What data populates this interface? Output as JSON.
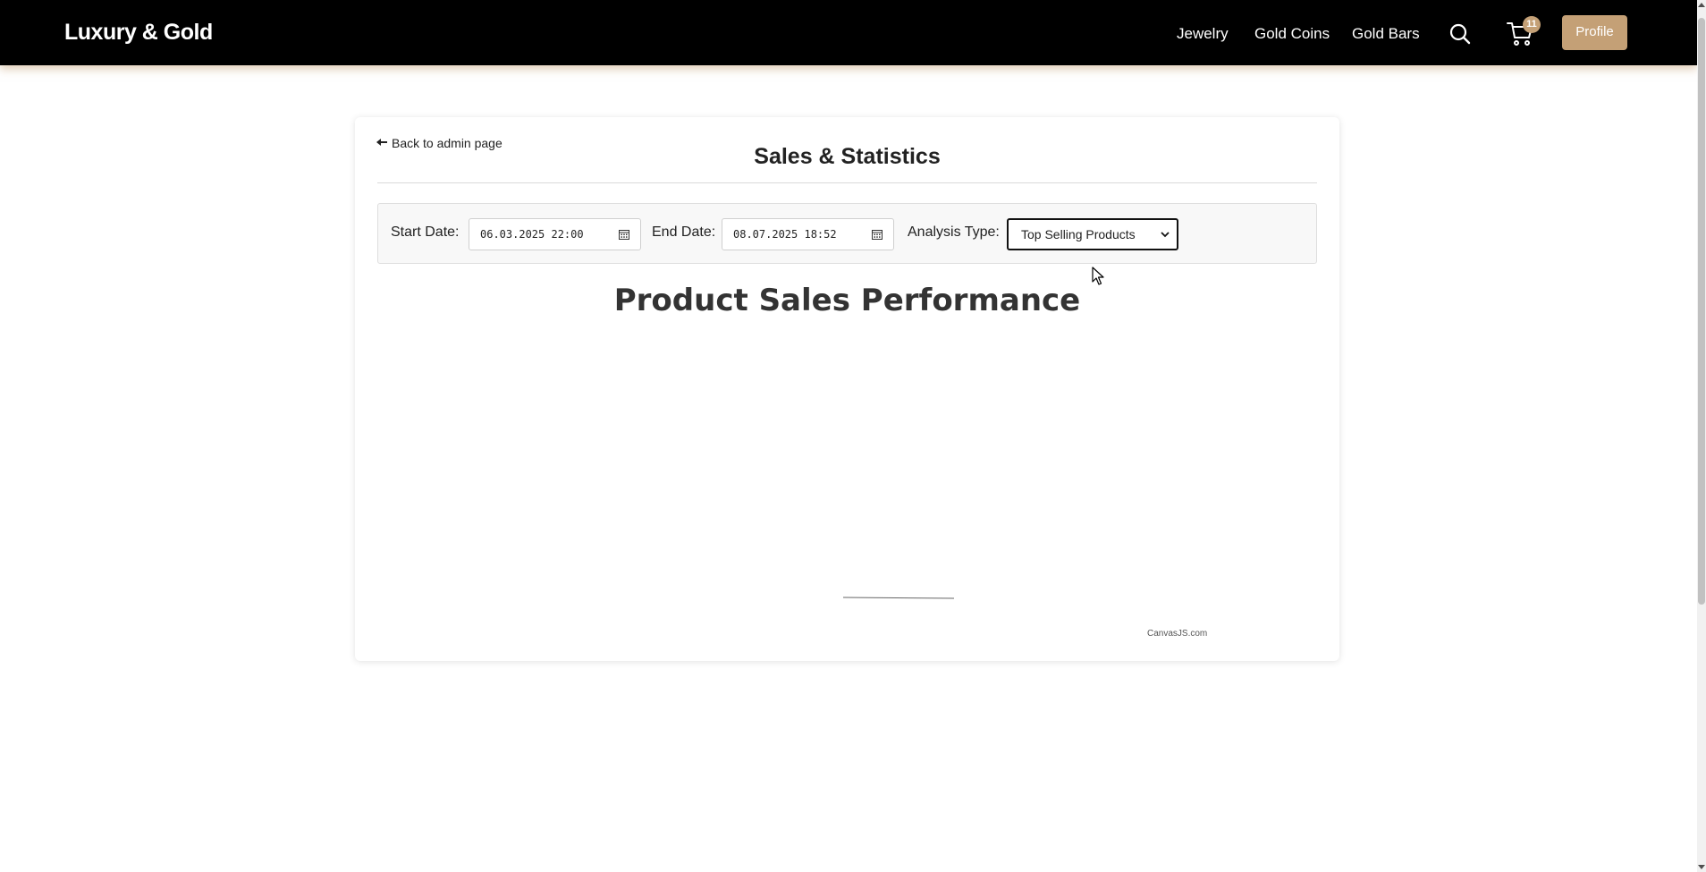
{
  "header": {
    "brand": "Luxury & Gold",
    "nav": [
      {
        "label": "Jewelry"
      },
      {
        "label": "Gold Coins"
      },
      {
        "label": "Gold Bars"
      }
    ],
    "icons": {
      "search": "search-icon",
      "cart": "cart-icon"
    },
    "cart_count": "11",
    "profile_label": "Profile",
    "colors": {
      "background": "#000000",
      "accent": "#c4a076"
    }
  },
  "page": {
    "back_link": "Back to admin page",
    "title": "Sales & Statistics"
  },
  "filters": {
    "start_label": "Start Date:",
    "start_value": "06.03.2025 22:00",
    "end_label": "End Date:",
    "end_value": "08.07.2025 18:52",
    "type_label": "Analysis Type:",
    "type_value": "Top Selling Products"
  },
  "chart_data": {
    "type": "bar",
    "title": "Product Sales Performance",
    "categories": [],
    "values": [],
    "credit": "CanvasJS.com"
  }
}
